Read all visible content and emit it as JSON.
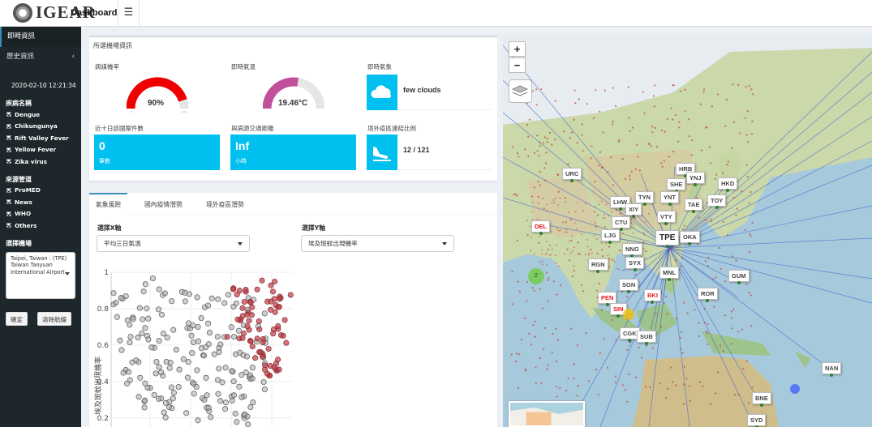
{
  "header": {
    "brand": "IGEAR",
    "subtitle": "Dashboard",
    "menu_icon": "hamburger-icon"
  },
  "sidebar": {
    "nav": [
      {
        "label": "即時資訊"
      },
      {
        "label": "歷史資訊"
      }
    ],
    "datetime": "2020-02-10 12:21:34",
    "disease_title": "疾病名稱",
    "diseases": [
      "Dengue",
      "Chikungunya",
      "Rift Valley Fever",
      "Yellow Fever",
      "Zika virus"
    ],
    "source_title": "來源管道",
    "sources": [
      "ProMED",
      "News",
      "WHO",
      "Others"
    ],
    "airport_title": "選擇機場",
    "airport_value": "Taipei, Taiwan : (TPE) Taiwan Taoyuan International Airport",
    "confirm_label": "確定",
    "clear_label": "清除航線"
  },
  "info": {
    "title": "所選機場資訊",
    "risk_label": "病媒機率",
    "risk_value": "90%",
    "risk_fraction": 0.9,
    "temp_label": "即時氣溫",
    "temp_value": "19.46°C",
    "temp_fraction": 0.55,
    "weather_label": "即時氣象",
    "weather_value": "few clouds",
    "cases_label": "近十日該國案件數",
    "cases_value": "0",
    "cases_unit": "筆數",
    "distance_label": "與病源交通距離",
    "distance_value": "Inf",
    "distance_unit": "小時",
    "ratio_label": "境外疫區連結比例",
    "ratio_value": "12 / 121"
  },
  "tabs": [
    {
      "label": "氣象風險"
    },
    {
      "label": "國內疫情潛勢"
    },
    {
      "label": "境外疫區潛勢"
    }
  ],
  "controls": {
    "x_label": "選擇X軸",
    "x_value": "平均三日氣溫",
    "y_label": "選擇Y軸",
    "y_value": "埃及斑蚊出現機率"
  },
  "chart_data": {
    "type": "scatter",
    "ylabel": "埃及斑蚊出現機率",
    "xlabel": "",
    "ylim": [
      0.15,
      1.0
    ],
    "yticks": [
      "1",
      "0.8",
      "0.6",
      "0.4",
      "0.2"
    ],
    "series": [
      {
        "points": [
          [
            2,
            0.86
          ],
          [
            3,
            0.71
          ],
          [
            4,
            0.62
          ],
          [
            5,
            0.49
          ],
          [
            6,
            0.38
          ],
          [
            7,
            0.29
          ],
          [
            8,
            0.92
          ],
          [
            9,
            0.79
          ],
          [
            10,
            0.66
          ],
          [
            11,
            0.54
          ],
          [
            12,
            0.43
          ],
          [
            13,
            0.33
          ],
          [
            14,
            0.24
          ],
          [
            15,
            0.88
          ],
          [
            16,
            0.74
          ],
          [
            17,
            0.61
          ],
          [
            18,
            0.51
          ],
          [
            19,
            0.41
          ],
          [
            20,
            0.3
          ],
          [
            21,
            0.21
          ],
          [
            22,
            0.83
          ],
          [
            23,
            0.69
          ],
          [
            24,
            0.57
          ],
          [
            25,
            0.46
          ],
          [
            26,
            0.36
          ],
          [
            27,
            0.27
          ],
          [
            28,
            0.18
          ],
          [
            29,
            0.81
          ],
          [
            30,
            0.66
          ],
          [
            31,
            0.52
          ],
          [
            32,
            0.4
          ]
        ]
      },
      {
        "points": [
          [
            27,
            0.9
          ],
          [
            28,
            0.82
          ],
          [
            29,
            0.76
          ],
          [
            30,
            0.7
          ],
          [
            31,
            0.62
          ],
          [
            32,
            0.55
          ],
          [
            33,
            0.48
          ],
          [
            34,
            0.86
          ],
          [
            35,
            0.79
          ],
          [
            36,
            0.72
          ],
          [
            33,
            0.92
          ],
          [
            30,
            0.87
          ],
          [
            28,
            0.74
          ],
          [
            26,
            0.65
          ],
          [
            31,
            0.58
          ],
          [
            35,
            0.64
          ],
          [
            36,
            0.84
          ],
          [
            34,
            0.5
          ],
          [
            32,
            0.45
          ]
        ]
      }
    ]
  },
  "map": {
    "zoom_in": "+",
    "zoom_out": "−",
    "labels": [
      {
        "code": "URC",
        "cls": ""
      },
      {
        "code": "DEL",
        "cls": "red"
      },
      {
        "code": "TPE",
        "cls": "big"
      },
      {
        "code": "HRB",
        "cls": ""
      },
      {
        "code": "YNJ",
        "cls": ""
      },
      {
        "code": "SHE",
        "cls": ""
      },
      {
        "code": "HKD",
        "cls": ""
      },
      {
        "code": "TYN",
        "cls": ""
      },
      {
        "code": "YNT",
        "cls": ""
      },
      {
        "code": "TAE",
        "cls": ""
      },
      {
        "code": "TOY",
        "cls": ""
      },
      {
        "code": "LHW",
        "cls": ""
      },
      {
        "code": "XIY",
        "cls": ""
      },
      {
        "code": "VTY",
        "cls": ""
      },
      {
        "code": "CTU",
        "cls": ""
      },
      {
        "code": "OKA",
        "cls": ""
      },
      {
        "code": "LJG",
        "cls": ""
      },
      {
        "code": "NNG",
        "cls": ""
      },
      {
        "code": "RGN",
        "cls": ""
      },
      {
        "code": "SYX",
        "cls": ""
      },
      {
        "code": "MNL",
        "cls": ""
      },
      {
        "code": "SGN",
        "cls": ""
      },
      {
        "code": "PEN",
        "cls": "red"
      },
      {
        "code": "SIN",
        "cls": "red"
      },
      {
        "code": "BKI",
        "cls": "red"
      },
      {
        "code": "ROR",
        "cls": ""
      },
      {
        "code": "GUM",
        "cls": ""
      },
      {
        "code": "CGK",
        "cls": ""
      },
      {
        "code": "SUB",
        "cls": ""
      },
      {
        "code": "NAN",
        "cls": ""
      },
      {
        "code": "BNE",
        "cls": ""
      },
      {
        "code": "SYD",
        "cls": ""
      }
    ],
    "cluster_count": "2"
  }
}
